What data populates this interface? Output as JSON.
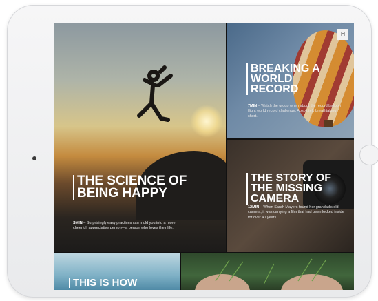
{
  "articles": [
    {
      "title": "THE SCIENCE OF BEING HAPPY",
      "tag": "SMIN",
      "excerpt": "– Surprisingly easy practices can mold you into a more cheerful, appreciative person—a person who loves their life."
    },
    {
      "title": "BREAKING A WORLD RECORD",
      "tag": "7MIN",
      "excerpt": "– Watch the group when about the record balloon flight world record challenge. Absolutely breathtaking short."
    },
    {
      "title": "THE STORY OF THE MISSING CAMERA",
      "tag": "12MIN",
      "excerpt": "– When Sarah Mayers found her grandad's old camera, it was carrying a film that had been locked inside for over 40 years."
    },
    {
      "title": "THIS IS HOW"
    }
  ],
  "app_logo": "H",
  "icons": {
    "logo": "app-logo-icon"
  }
}
